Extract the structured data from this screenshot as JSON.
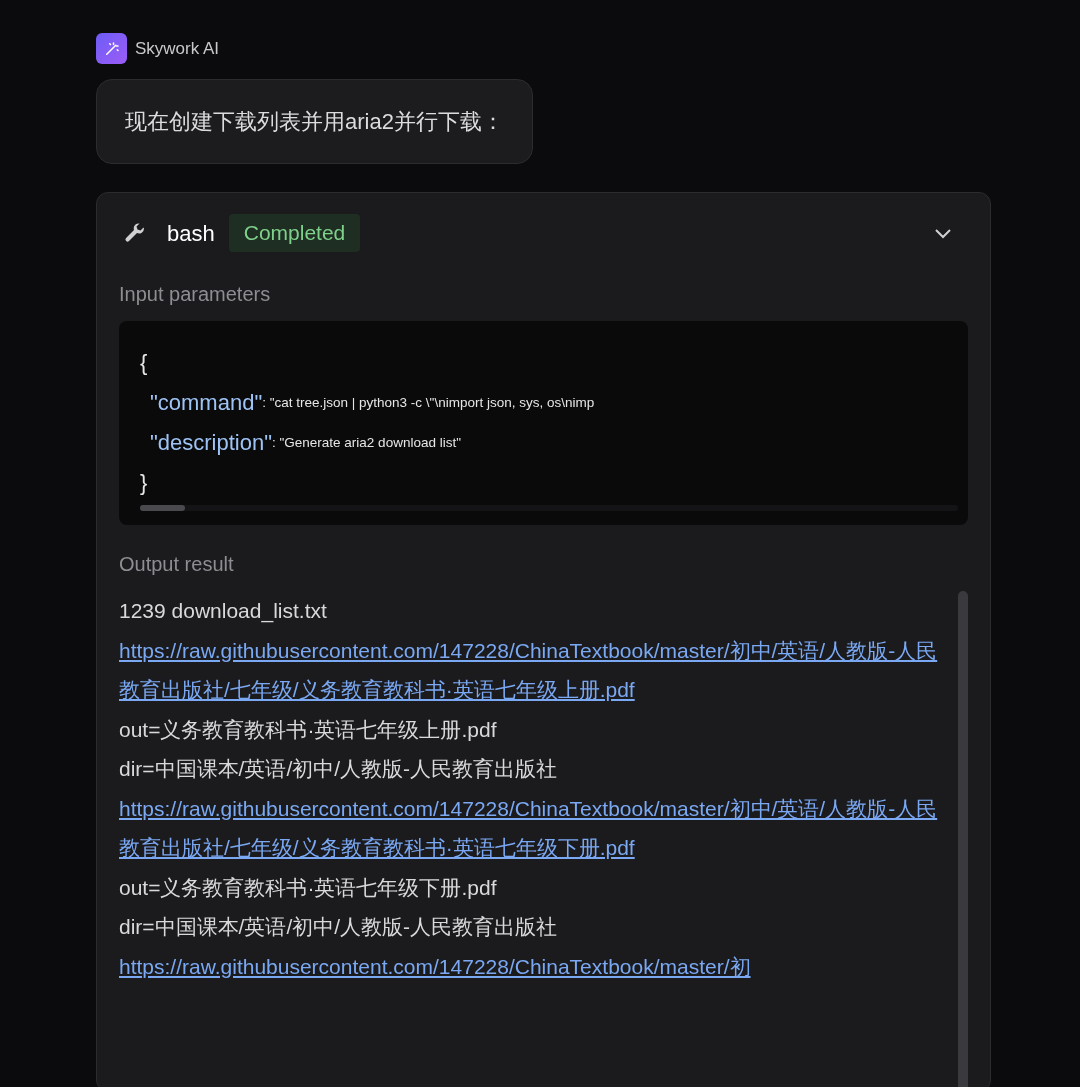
{
  "assistant": {
    "name": "Skywork AI"
  },
  "message": {
    "text": "现在创建下载列表并用aria2并行下载："
  },
  "tool_card": {
    "tool": "bash",
    "status": {
      "label": "Completed",
      "kind": "success"
    },
    "expanded": true,
    "input_label": "Input parameters",
    "code": {
      "open": "{",
      "close": "}",
      "params": [
        {
          "key": "\"command\"",
          "value": ": \"cat tree.json | python3 -c \\\"\\nimport json, sys, os\\nimp"
        },
        {
          "key": "\"description\"",
          "value": ": \"Generate aria2 download list\""
        }
      ]
    },
    "output_label": "Output result",
    "output": [
      {
        "kind": "text",
        "text": "1239 download_list.txt"
      },
      {
        "kind": "link",
        "text": "https://raw.githubusercontent.com/147228/ChinaTextbook/master/初中/英语/人教版-人民教育出版社/七年级/义务教育教科书·英语七年级上册.pdf"
      },
      {
        "kind": "text",
        "text": "out=义务教育教科书·英语七年级上册.pdf"
      },
      {
        "kind": "text",
        "text": "dir=中国课本/英语/初中/人教版-人民教育出版社"
      },
      {
        "kind": "link",
        "text": "https://raw.githubusercontent.com/147228/ChinaTextbook/master/初中/英语/人教版-人民教育出版社/七年级/义务教育教科书·英语七年级下册.pdf"
      },
      {
        "kind": "text",
        "text": "out=义务教育教科书·英语七年级下册.pdf"
      },
      {
        "kind": "text",
        "text": "dir=中国课本/英语/初中/人教版-人民教育出版社"
      },
      {
        "kind": "link",
        "text": "https://raw.githubusercontent.com/147228/ChinaTextbook/master/初"
      }
    ]
  }
}
